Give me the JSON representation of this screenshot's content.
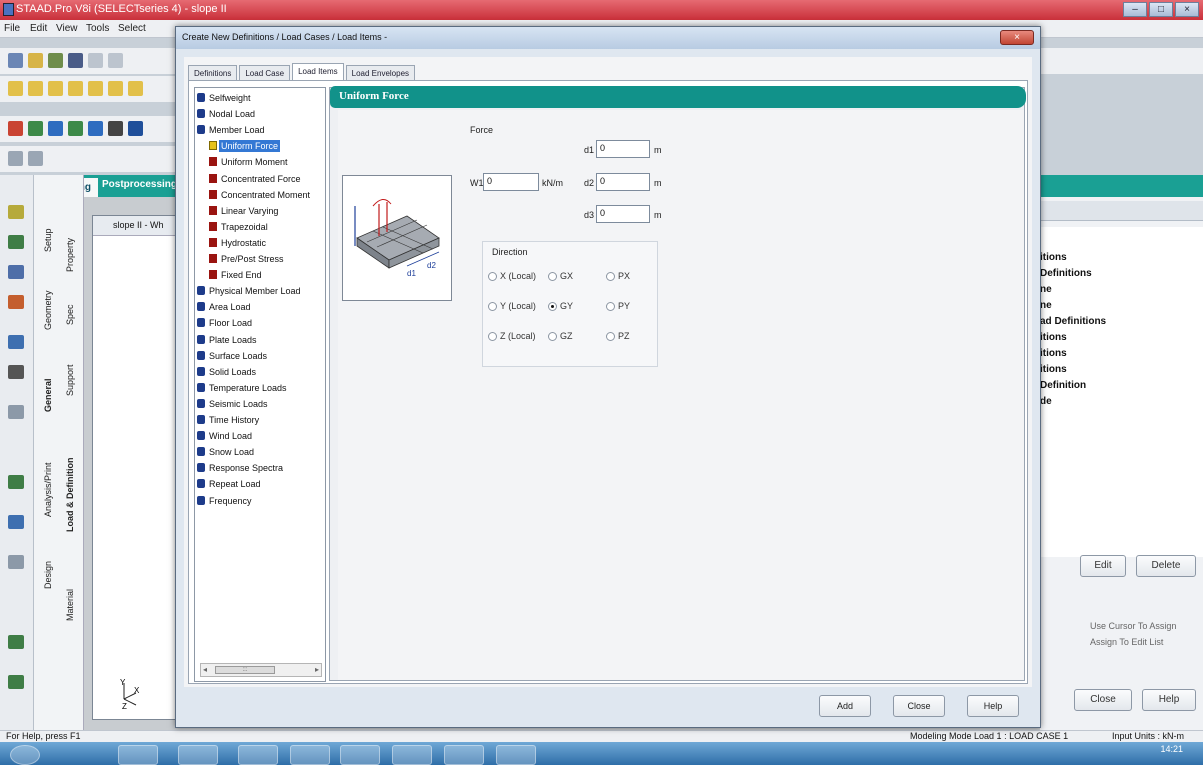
{
  "app": {
    "title": "STAAD.Pro V8i (SELECTseries 4) - slope II",
    "menu": [
      "File",
      "Edit",
      "View",
      "Tools",
      "Select"
    ],
    "module_tabs": {
      "modeling": "Modeling",
      "post": "Postprocessing"
    },
    "viewport_title": "slope II - Wh",
    "left_tabs": [
      "Setup",
      "Geometry",
      "General",
      "Analysis/Print",
      "Design"
    ],
    "left_tabs2": [
      "Property",
      "Spec",
      "Support",
      "Load & Definition",
      "Material"
    ]
  },
  "dialog": {
    "title": "Create New Definitions / Load Cases / Load Items -",
    "close_label": "×",
    "tabs": [
      "Definitions",
      "Load Case",
      "Load Items",
      "Load Envelopes"
    ],
    "active_tab": "Load Items",
    "tree": [
      {
        "label": "Selfweight",
        "icon": "blue",
        "level": 0
      },
      {
        "label": "Nodal Load",
        "icon": "blue",
        "level": 0
      },
      {
        "label": "Member Load",
        "icon": "blue",
        "level": 0
      },
      {
        "label": "Uniform Force",
        "icon": "yellow",
        "level": 1,
        "selected": true
      },
      {
        "label": "Uniform Moment",
        "icon": "red",
        "level": 1
      },
      {
        "label": "Concentrated Force",
        "icon": "red",
        "level": 1
      },
      {
        "label": "Concentrated Moment",
        "icon": "red",
        "level": 1
      },
      {
        "label": "Linear Varying",
        "icon": "red",
        "level": 1
      },
      {
        "label": "Trapezoidal",
        "icon": "red",
        "level": 1
      },
      {
        "label": "Hydrostatic",
        "icon": "red",
        "level": 1
      },
      {
        "label": "Pre/Post Stress",
        "icon": "red",
        "level": 1
      },
      {
        "label": "Fixed End",
        "icon": "red",
        "level": 1
      },
      {
        "label": "Physical Member Load",
        "icon": "blue",
        "level": 0
      },
      {
        "label": "Area Load",
        "icon": "blue",
        "level": 0
      },
      {
        "label": "Floor Load",
        "icon": "blue",
        "level": 0
      },
      {
        "label": "Plate Loads",
        "icon": "blue",
        "level": 0
      },
      {
        "label": "Surface Loads",
        "icon": "blue",
        "level": 0
      },
      {
        "label": "Solid Loads",
        "icon": "blue",
        "level": 0
      },
      {
        "label": "Temperature Loads",
        "icon": "blue",
        "level": 0
      },
      {
        "label": "Seismic Loads",
        "icon": "blue",
        "level": 0
      },
      {
        "label": "Time History",
        "icon": "blue",
        "level": 0
      },
      {
        "label": "Wind Load",
        "icon": "blue",
        "level": 0
      },
      {
        "label": "Snow Load",
        "icon": "blue",
        "level": 0
      },
      {
        "label": "Response Spectra",
        "icon": "blue",
        "level": 0
      },
      {
        "label": "Repeat Load",
        "icon": "blue",
        "level": 0
      },
      {
        "label": "Frequency",
        "icon": "blue",
        "level": 0
      }
    ],
    "panel_title": "Uniform Force",
    "force": {
      "group_label": "Force",
      "w1_label": "W1",
      "w1_value": "0",
      "w1_unit": "kN/m",
      "d1_label": "d1",
      "d1_value": "0",
      "d2_label": "d2",
      "d2_value": "0",
      "d3_label": "d3",
      "d3_value": "0",
      "d_unit": "m"
    },
    "direction": {
      "label": "Direction",
      "options": [
        [
          "X (Local)",
          "GX",
          "PX"
        ],
        [
          "Y (Local)",
          "GY",
          "PY"
        ],
        [
          "Z (Local)",
          "GZ",
          "PZ"
        ]
      ],
      "selected": "GY"
    },
    "buttons": {
      "add": "Add",
      "close": "Close",
      "help": "Help"
    }
  },
  "right_panel": {
    "items": [
      "itions",
      "Definitions",
      "ne",
      "ne",
      "ad Definitions",
      "itions",
      "itions",
      "itions",
      "Definition",
      "de"
    ],
    "edit": "Edit",
    "delete": "Delete",
    "opt1": "Use Cursor To Assign",
    "opt2": "Assign To Edit List",
    "close": "Close",
    "help": "Help"
  },
  "status": {
    "help": "For Help, press F1",
    "mode": "Modeling Mode  Load 1 : LOAD CASE 1",
    "units": "Input Units : kN-m",
    "time": "14:21"
  },
  "colors": {
    "accent": "#11928a",
    "selection": "#3478d4"
  }
}
